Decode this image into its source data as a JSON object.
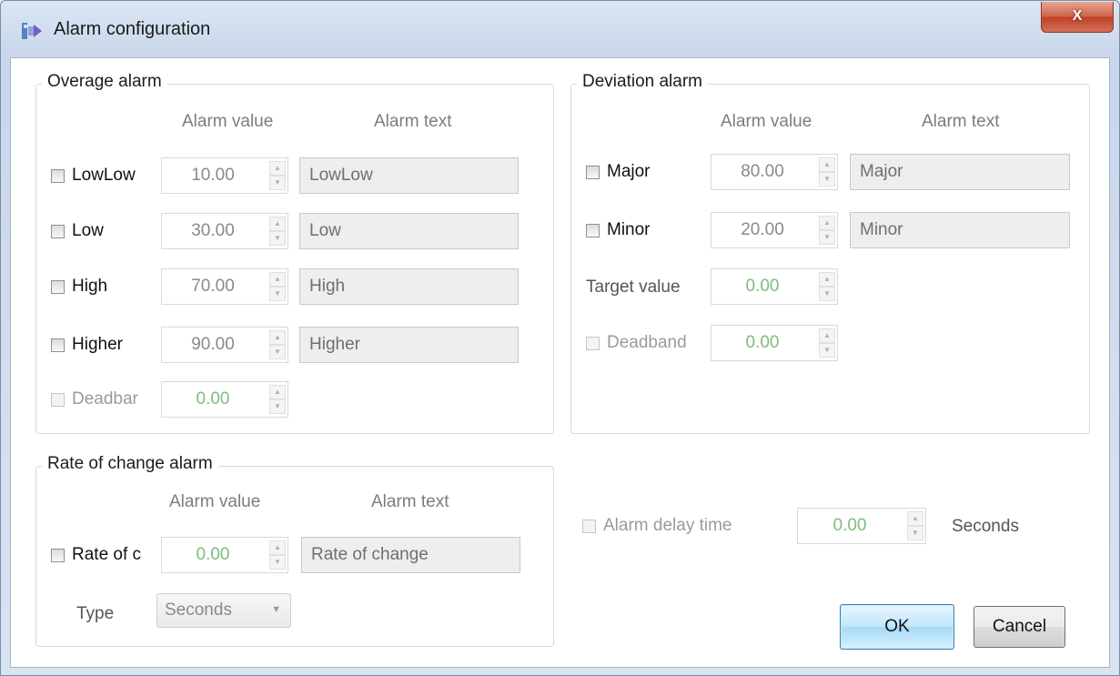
{
  "window": {
    "title": "Alarm configuration",
    "close_label": "X"
  },
  "overage": {
    "title": "Overage alarm",
    "col_value": "Alarm value",
    "col_text": "Alarm text",
    "rows": [
      {
        "label": "LowLow",
        "value": "10.00",
        "text": "LowLow"
      },
      {
        "label": "Low",
        "value": "30.00",
        "text": "Low"
      },
      {
        "label": "High",
        "value": "70.00",
        "text": "High"
      },
      {
        "label": "Higher",
        "value": "90.00",
        "text": "Higher"
      }
    ],
    "deadband_label": "Deadbar",
    "deadband_value": "0.00"
  },
  "deviation": {
    "title": "Deviation alarm",
    "col_value": "Alarm value",
    "col_text": "Alarm text",
    "rows": [
      {
        "label": "Major",
        "value": "80.00",
        "text": "Major"
      },
      {
        "label": "Minor",
        "value": "20.00",
        "text": "Minor"
      }
    ],
    "target_label": "Target value",
    "target_value": "0.00",
    "deadband_label": "Deadband",
    "deadband_value": "0.00"
  },
  "rate": {
    "title": "Rate of change alarm",
    "col_value": "Alarm value",
    "col_text": "Alarm text",
    "label": "Rate of c",
    "value": "0.00",
    "text": "Rate of change",
    "type_label": "Type",
    "type_value": "Seconds"
  },
  "delay": {
    "label": "Alarm delay time",
    "value": "0.00",
    "unit": "Seconds"
  },
  "buttons": {
    "ok": "OK",
    "cancel": "Cancel"
  },
  "icons": {
    "app": "app-icon",
    "spin_up": "▲",
    "spin_down": "▼",
    "dropdown": "▼"
  }
}
